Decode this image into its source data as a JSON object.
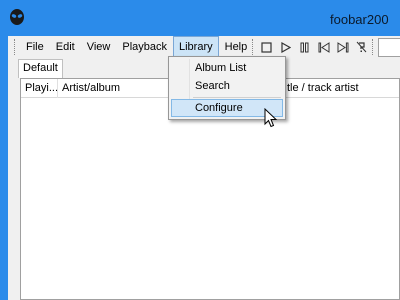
{
  "window": {
    "title": "foobar200",
    "icon": "alien-icon"
  },
  "menu": {
    "items": [
      {
        "label": "File"
      },
      {
        "label": "Edit"
      },
      {
        "label": "View"
      },
      {
        "label": "Playback"
      },
      {
        "label": "Library",
        "active": true
      },
      {
        "label": "Help"
      }
    ]
  },
  "toolbar": {
    "buttons": [
      "stop-icon",
      "play-icon",
      "pause-icon",
      "previous-icon",
      "next-icon",
      "random-icon"
    ]
  },
  "tabs": [
    {
      "label": "Default"
    }
  ],
  "playlist": {
    "columns": [
      {
        "label": "Playi..."
      },
      {
        "label": "Artist/album"
      },
      {
        "label": "tle / track artist"
      }
    ]
  },
  "library_menu": {
    "items": [
      {
        "label": "Album List"
      },
      {
        "label": "Search"
      },
      {
        "label": "Configure",
        "hovered": true
      }
    ]
  },
  "colors": {
    "titlebar": "#2b8bea",
    "highlight": "#d1e6f8"
  }
}
